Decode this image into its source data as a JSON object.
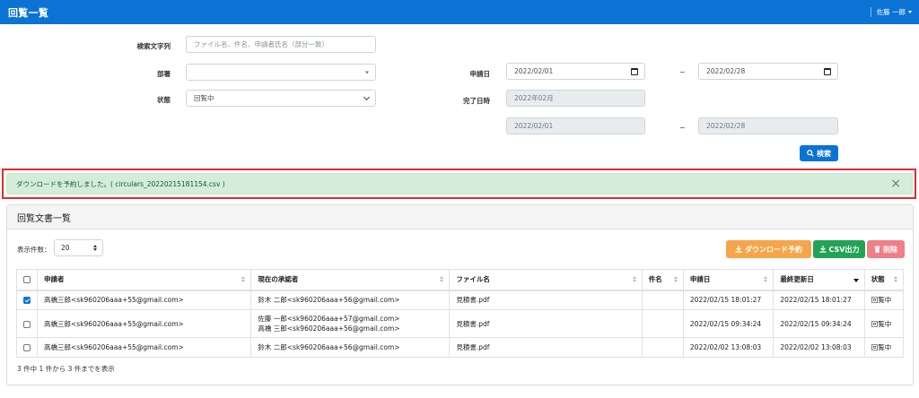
{
  "header": {
    "title": "回覧一覧",
    "user": "佐藤 一郎"
  },
  "search": {
    "keyword_label": "検索文字列",
    "keyword_placeholder": "ファイル名、件名、申請者氏名（部分一致）",
    "dept_label": "部署",
    "dept_value": "",
    "status_label": "状態",
    "status_value": "回覧中",
    "apply_date_label": "申請日",
    "apply_from": "2022/02/01",
    "apply_to": "2022/02/28",
    "complete_label": "完了日時",
    "complete_month": "2022年02月",
    "complete_from": "2022/02/01",
    "complete_to": "2022/02/28",
    "tilde": "~",
    "search_button": "検索"
  },
  "alert": {
    "message": "ダウンロードを予約しました。( circulars_20220215181154.csv )",
    "close": "×"
  },
  "list": {
    "title": "回覧文書一覧",
    "per_page_label": "表示件数：",
    "per_page_value": "20",
    "btn_download": "ダウンロード予約",
    "btn_csv": "CSV出力",
    "btn_delete": "削除",
    "columns": [
      "申請者",
      "現在の承認者",
      "ファイル名",
      "件名",
      "申請日",
      "最終更新日",
      "状態"
    ],
    "rows": [
      {
        "checked": true,
        "applicant": "高橋三郎<sk960206aaa+55@gmail.com>",
        "approver": "鈴木 二郎<sk960206aaa+56@gmail.com>",
        "approver2": "",
        "file": "見積書.pdf",
        "subject": "",
        "applied": "2022/02/15 18:01:27",
        "updated": "2022/02/15 18:01:27",
        "status": "回覧中"
      },
      {
        "checked": false,
        "applicant": "高橋三郎<sk960206aaa+55@gmail.com>",
        "approver": "佐藤 一郎<sk960206aaa+57@gmail.com>",
        "approver2": "高橋 三郎<sk960206aaa+56@gmail.com>",
        "file": "見積書.pdf",
        "subject": "",
        "applied": "2022/02/15 09:34:24",
        "updated": "2022/02/15 09:34:24",
        "status": "回覧中"
      },
      {
        "checked": false,
        "applicant": "高橋三郎<sk960206aaa+55@gmail.com>",
        "approver": "鈴木 二郎<sk960206aaa+56@gmail.com>",
        "approver2": "",
        "file": "見積書.pdf",
        "subject": "",
        "applied": "2022/02/02 13:08:03",
        "updated": "2022/02/02 13:08:03",
        "status": "回覧中"
      }
    ],
    "summary": "3 件中 1 件から 3 件までを表示"
  },
  "colors": {
    "primary": "#0a73d4",
    "success_bg": "#d4edda",
    "warning": "#f6a54a",
    "green": "#22a356",
    "danger": "#ef7f86",
    "highlight": "#e02b2b"
  }
}
